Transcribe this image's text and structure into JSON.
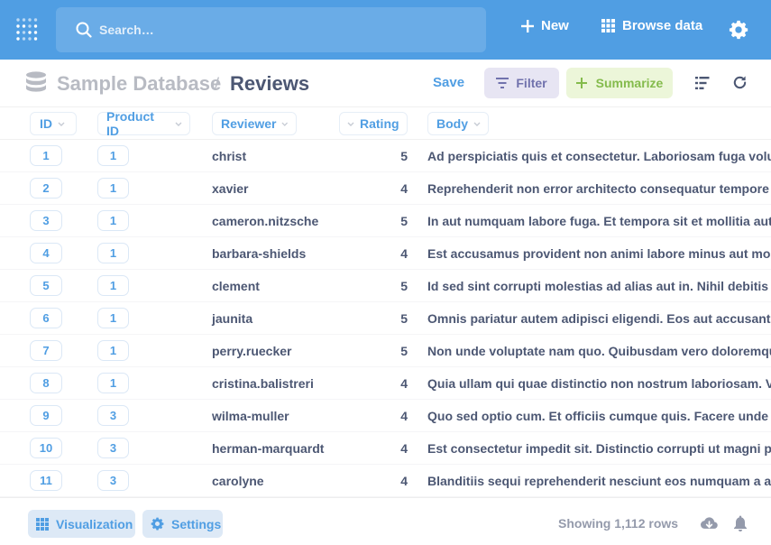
{
  "nav": {
    "search_placeholder": "Search…",
    "new_label": "New",
    "browse_label": "Browse data"
  },
  "header": {
    "database": "Sample Database",
    "separator": "/",
    "table": "Reviews",
    "save_label": "Save",
    "filter_label": "Filter",
    "summarize_label": "Summarize"
  },
  "columns": {
    "id": "ID",
    "product_id": "Product ID",
    "reviewer": "Reviewer",
    "rating": "Rating",
    "body": "Body"
  },
  "rows": [
    {
      "id": "1",
      "product_id": "1",
      "reviewer": "christ",
      "rating": "5",
      "body": "Ad perspiciatis quis et consectetur. Laboriosam fuga voluptas u"
    },
    {
      "id": "2",
      "product_id": "1",
      "reviewer": "xavier",
      "rating": "4",
      "body": "Reprehenderit non error architecto consequatur tempore temp"
    },
    {
      "id": "3",
      "product_id": "1",
      "reviewer": "cameron.nitzsche",
      "rating": "5",
      "body": "In aut numquam labore fuga. Et tempora sit et mollitia aut ullar"
    },
    {
      "id": "4",
      "product_id": "1",
      "reviewer": "barbara-shields",
      "rating": "4",
      "body": "Est accusamus provident non animi labore minus aut mollitia. C"
    },
    {
      "id": "5",
      "product_id": "1",
      "reviewer": "clement",
      "rating": "5",
      "body": "Id sed sint corrupti molestias ad alias aut in. Nihil debitis ipsum"
    },
    {
      "id": "6",
      "product_id": "1",
      "reviewer": "jaunita",
      "rating": "5",
      "body": "Omnis pariatur autem adipisci eligendi. Eos aut accusantium do"
    },
    {
      "id": "7",
      "product_id": "1",
      "reviewer": "perry.ruecker",
      "rating": "5",
      "body": "Non unde voluptate nam quo. Quibusdam vero doloremque ut"
    },
    {
      "id": "8",
      "product_id": "1",
      "reviewer": "cristina.balistreri",
      "rating": "4",
      "body": "Quia ullam qui quae distinctio non nostrum laboriosam. Volupt"
    },
    {
      "id": "9",
      "product_id": "3",
      "reviewer": "wilma-muller",
      "rating": "4",
      "body": "Quo sed optio cum. Et officiis cumque quis. Facere unde porro"
    },
    {
      "id": "10",
      "product_id": "3",
      "reviewer": "herman-marquardt",
      "rating": "4",
      "body": "Est consectetur impedit sit. Distinctio corrupti ut magni provid"
    },
    {
      "id": "11",
      "product_id": "3",
      "reviewer": "carolyne",
      "rating": "4",
      "body": "Blanditiis sequi reprehenderit nesciunt eos numquam a alias qu"
    }
  ],
  "footer": {
    "visualization_label": "Visualization",
    "settings_label": "Settings",
    "row_count": "Showing 1,112 rows"
  },
  "icons": {
    "logo": "metabase-logo-icon",
    "search": "search-icon",
    "new": "plus-icon",
    "browse": "grid-icon",
    "settings": "gear-icon",
    "database": "database-icon",
    "filter": "filter-icon",
    "summarize": "plus-icon",
    "notebook": "list-icon",
    "refresh": "refresh-icon",
    "download": "download-icon",
    "alert": "bell-icon"
  },
  "colors": {
    "brand": "#509ee3",
    "filter": "#7172ad",
    "summarize": "#84bb4c",
    "text": "#4c5773",
    "muted": "#949aab"
  }
}
